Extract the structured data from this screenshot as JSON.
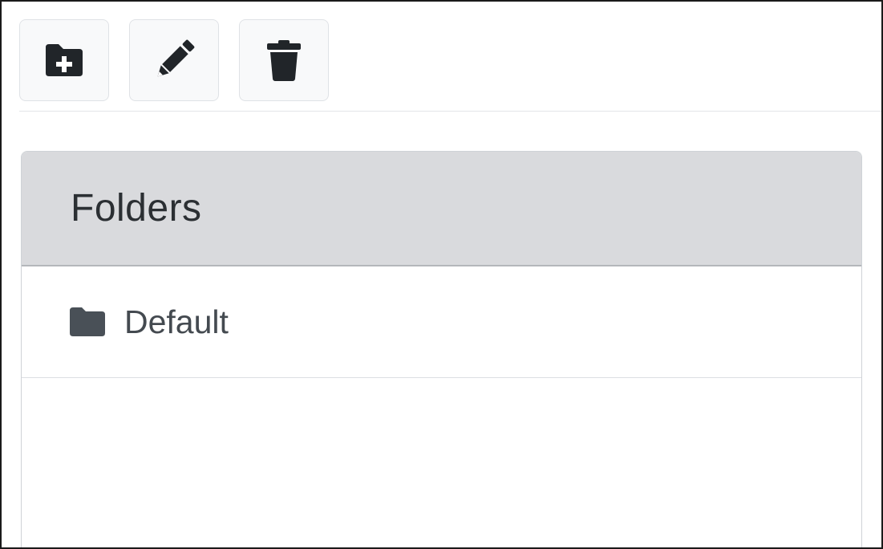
{
  "toolbar": {
    "buttons": [
      {
        "name": "new-folder-button",
        "icon": "folder-plus-icon"
      },
      {
        "name": "edit-button",
        "icon": "pencil-icon"
      },
      {
        "name": "delete-button",
        "icon": "trash-icon"
      }
    ]
  },
  "folders": {
    "title": "Folders",
    "items": [
      {
        "label": "Default",
        "icon": "folder-icon"
      }
    ]
  },
  "colors": {
    "icon_dark": "#212529",
    "folder_icon": "#495057",
    "header_bg": "#d9dadd"
  }
}
